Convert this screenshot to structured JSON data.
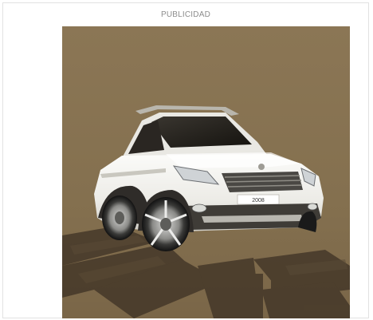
{
  "ad": {
    "label": "PUBLICIDAD",
    "banner": {
      "image": "car-advertisement",
      "plate_text": "2008",
      "background_color": "#8a7553",
      "car_color": "#f1f0ec"
    }
  }
}
